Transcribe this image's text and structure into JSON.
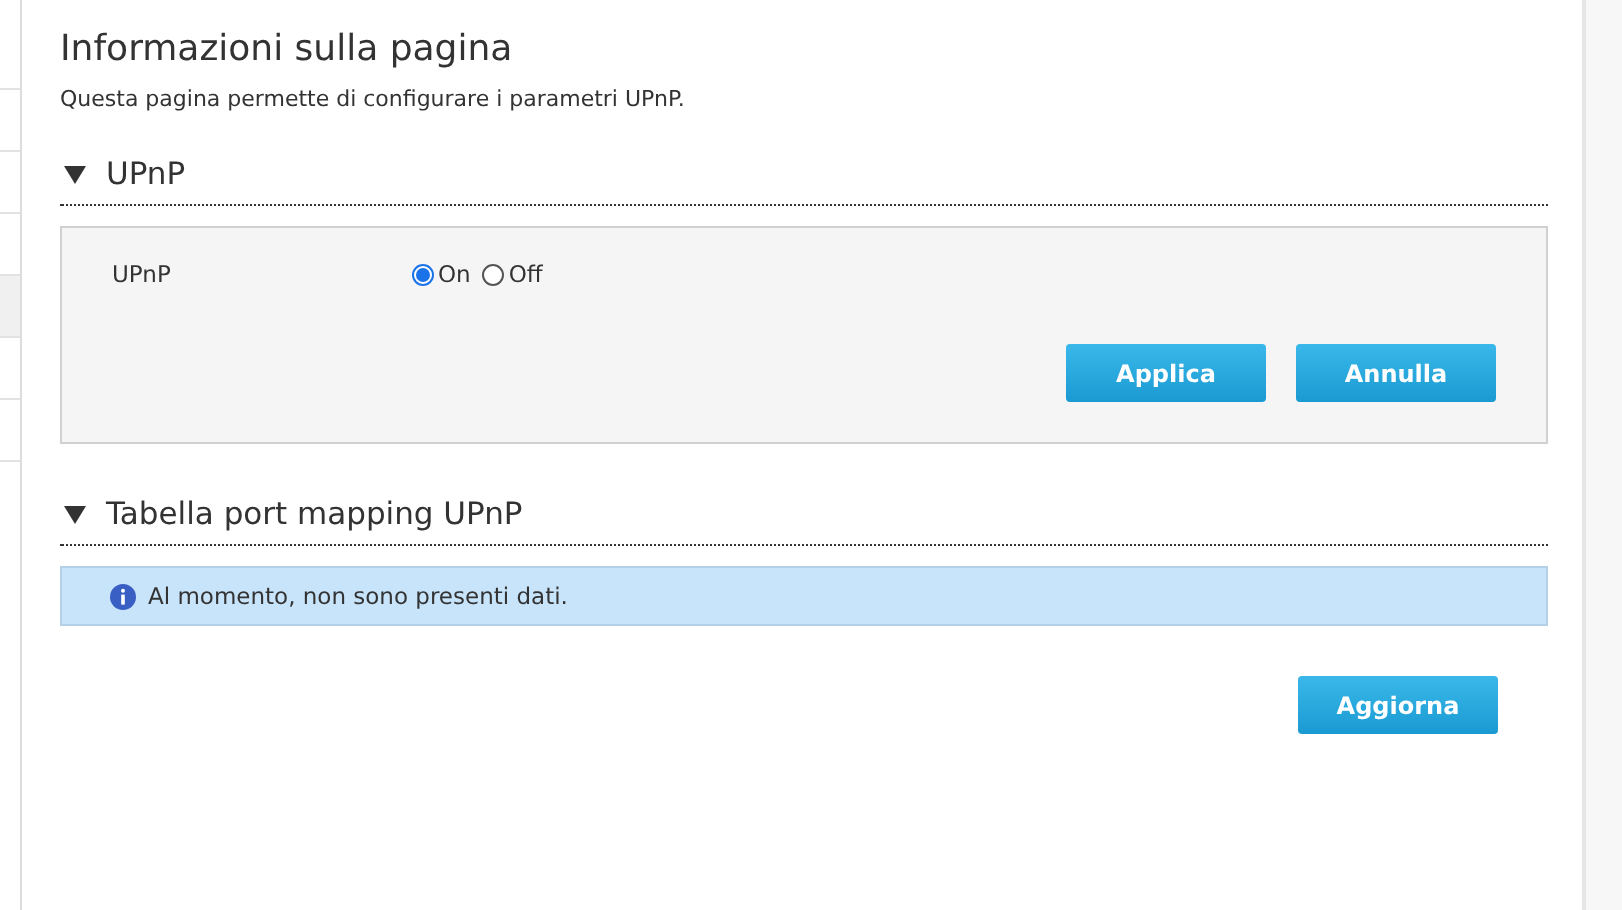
{
  "page": {
    "title": "Informazioni sulla pagina",
    "description": "Questa pagina permette di configurare i parametri UPnP."
  },
  "sections": [
    {
      "title": "UPnP",
      "expanded": true,
      "kind": "form",
      "field": {
        "label": "UPnP",
        "options": [
          {
            "label": "On",
            "selected": true
          },
          {
            "label": "Off",
            "selected": false
          }
        ]
      },
      "buttons": [
        "Applica",
        "Annulla"
      ]
    },
    {
      "title": "Tabella port mapping UPnP",
      "expanded": true,
      "kind": "table",
      "message": "Al momento, non sono presenti dati.",
      "buttons": [
        "Aggiorna"
      ]
    }
  ]
}
